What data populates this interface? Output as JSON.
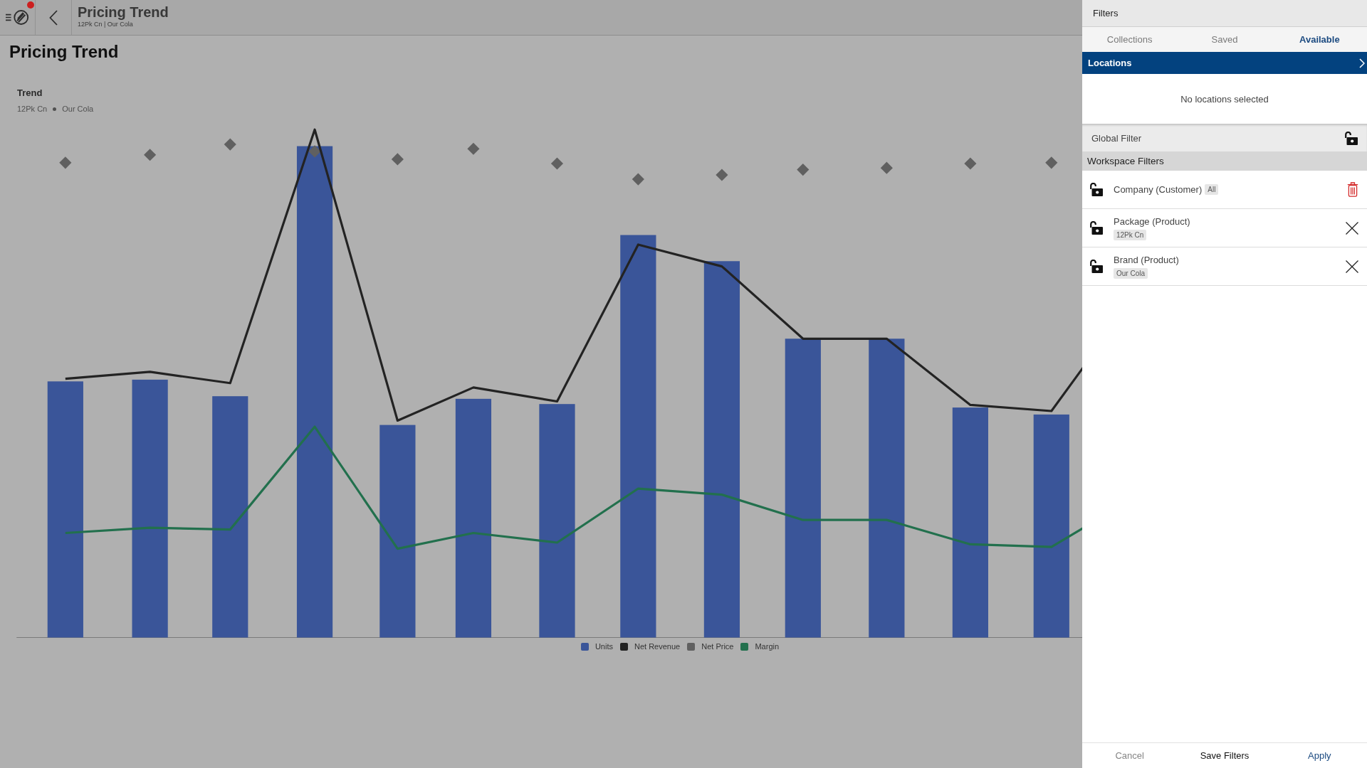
{
  "header": {
    "title": "Pricing Trend",
    "subtitle": "12Pk Cn | Our Cola",
    "notification": true
  },
  "page_title": "Pricing Trend",
  "chart": {
    "title": "Trend",
    "subtitle_parts": [
      "12Pk Cn",
      "Our Cola"
    ],
    "legend": [
      {
        "label": "Units",
        "color": "#3a5599"
      },
      {
        "label": "Net Revenue",
        "color": "#232323"
      },
      {
        "label": "Net Price",
        "color": "#606060"
      },
      {
        "label": "Margin",
        "color": "#22704d"
      }
    ]
  },
  "filters_panel": {
    "title": "Filters",
    "tabs": [
      {
        "label": "Collections",
        "selected": false
      },
      {
        "label": "Saved",
        "selected": false
      },
      {
        "label": "Available",
        "selected": true
      }
    ],
    "locations": {
      "label": "Locations",
      "empty_text": "No locations selected"
    },
    "global_filter": {
      "label": "Global Filter",
      "locked": false
    },
    "workspace_filters": {
      "title": "Workspace Filters",
      "items": [
        {
          "name": "Company (Customer)",
          "value": "All",
          "kind": "all",
          "locked": false
        },
        {
          "name": "Package (Product)",
          "value": "12Pk Cn",
          "kind": "picked",
          "locked": false
        },
        {
          "name": "Brand (Product)",
          "value": "Our Cola",
          "kind": "picked",
          "locked": false
        }
      ]
    },
    "footer_buttons": [
      {
        "label": "Cancel",
        "kind": "cancel"
      },
      {
        "label": "Save Filters",
        "kind": "save"
      },
      {
        "label": "Apply",
        "kind": "apply"
      }
    ]
  }
}
